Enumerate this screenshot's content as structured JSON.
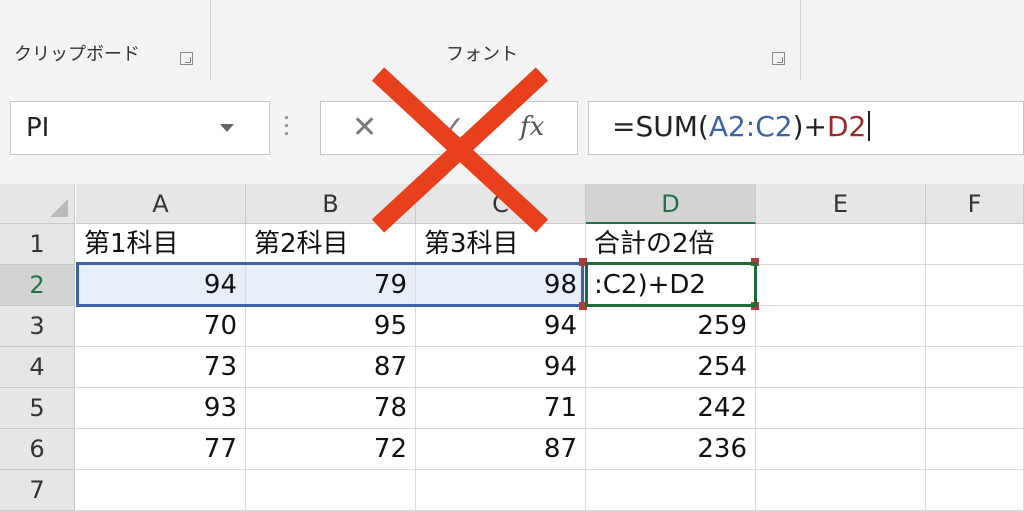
{
  "ribbon": {
    "clipboard_label": "クリップボード",
    "font_label": "フォント"
  },
  "formula_bar": {
    "name_box": "PI",
    "cancel_symbol": "✕",
    "enter_symbol": "✓",
    "fx_label": "fx",
    "formula_parts": [
      {
        "text": "=SUM(",
        "color": "#222222"
      },
      {
        "text": "A2:C2",
        "color": "#3c63a5"
      },
      {
        "text": ")+",
        "color": "#222222"
      },
      {
        "text": "D2",
        "color": "#9b2a2a"
      }
    ]
  },
  "sheet": {
    "columns": [
      "A",
      "B",
      "C",
      "D",
      "E",
      "F"
    ],
    "rows": [
      {
        "num": "1",
        "cells": [
          "第1科目",
          "第2科目",
          "第3科目",
          "合計の2倍"
        ]
      },
      {
        "num": "2",
        "cells": [
          "94",
          "79",
          "98",
          ":C2)+D2"
        ]
      },
      {
        "num": "3",
        "cells": [
          "70",
          "95",
          "94",
          "259"
        ]
      },
      {
        "num": "4",
        "cells": [
          "73",
          "87",
          "94",
          "254"
        ]
      },
      {
        "num": "5",
        "cells": [
          "93",
          "78",
          "71",
          "242"
        ]
      },
      {
        "num": "6",
        "cells": [
          "77",
          "72",
          "87",
          "236"
        ]
      },
      {
        "num": "7",
        "cells": [
          "",
          "",
          "",
          ""
        ]
      }
    ]
  },
  "colors": {
    "range_outline": "#3c63a5",
    "active_outline": "#1f6b3a",
    "cross": "#e8401c"
  }
}
